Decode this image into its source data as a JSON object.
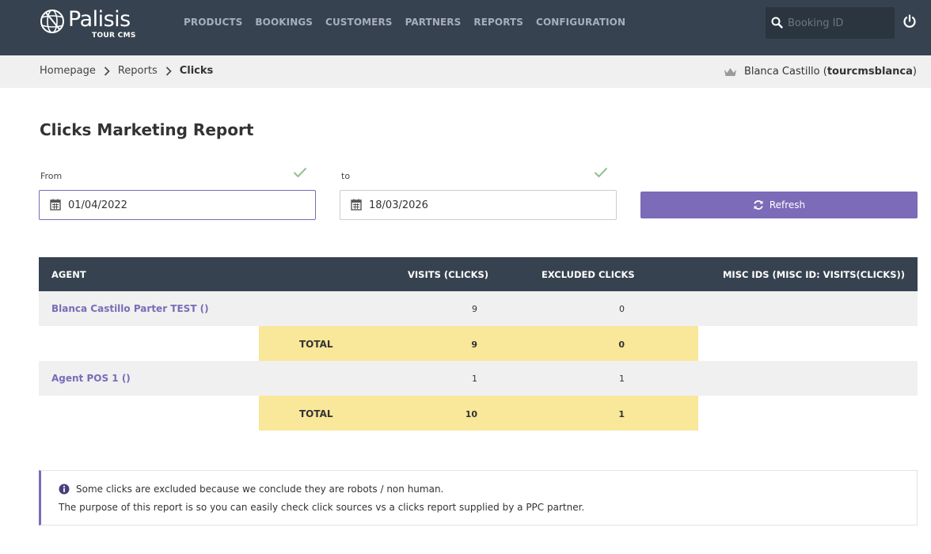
{
  "header": {
    "brand": "Palisis",
    "brand_sub": "TOUR CMS",
    "nav": [
      "PRODUCTS",
      "BOOKINGS",
      "CUSTOMERS",
      "PARTNERS",
      "REPORTS",
      "CONFIGURATION"
    ],
    "search_placeholder": "Booking ID"
  },
  "breadcrumb": {
    "items": [
      "Homepage",
      "Reports"
    ],
    "current": "Clicks"
  },
  "user": {
    "name": "Blanca Castillo",
    "username": "tourcmsblanca"
  },
  "page_title": "Clicks Marketing Report",
  "filters": {
    "from_label": "From",
    "from_value": "01/04/2022",
    "to_label": "to",
    "to_value": "18/03/2026",
    "refresh_label": "Refresh"
  },
  "table": {
    "columns": [
      "AGENT",
      "VISITS (CLICKS)",
      "EXCLUDED CLICKS",
      "MISC IDS (MISC ID: VISITS(CLICKS))"
    ],
    "rows": [
      {
        "agent": "Blanca Castillo Parter TEST ()",
        "visits": "9",
        "excluded": "0",
        "total_label": "TOTAL",
        "total_visits": "9",
        "total_excluded": "0"
      },
      {
        "agent": "Agent POS 1 ()",
        "visits": "1",
        "excluded": "1",
        "total_label": "TOTAL",
        "total_visits": "10",
        "total_excluded": "1"
      }
    ]
  },
  "note": {
    "line1": "Some clicks are excluded because we conclude they are robots / non human.",
    "line2": "The purpose of this report is so you can easily check click sources vs a clicks report supplied by a PPC partner."
  },
  "colors": {
    "topbar": "#36424f",
    "accent": "#7b6bb8",
    "total_bg": "#f9e79a",
    "check": "#8fc08f"
  }
}
